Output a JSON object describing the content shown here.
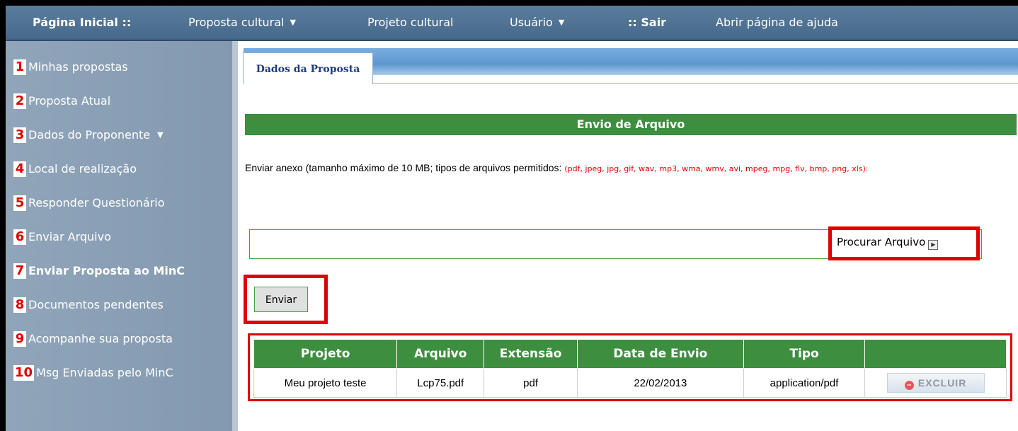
{
  "topbar": {
    "home": "Página Inicial ::",
    "menu": [
      {
        "label": "Proposta cultural",
        "dropdown": true
      },
      {
        "label": "Projeto cultural",
        "dropdown": false
      },
      {
        "label": "Usuário",
        "dropdown": true
      },
      {
        "label": ":: Sair",
        "dropdown": false
      },
      {
        "label": "Abrir página de ajuda",
        "dropdown": false
      }
    ]
  },
  "sidebar": {
    "items": [
      {
        "num": "1",
        "label": "Minhas propostas"
      },
      {
        "num": "2",
        "label": "Proposta Atual"
      },
      {
        "num": "3",
        "label": "Dados do Proponente"
      },
      {
        "num": "4",
        "label": "Local de realização"
      },
      {
        "num": "5",
        "label": "Responder Questionário"
      },
      {
        "num": "6",
        "label": "Enviar Arquivo"
      },
      {
        "num": "7",
        "label": "Enviar Proposta ao MinC"
      },
      {
        "num": "8",
        "label": "Documentos pendentes"
      },
      {
        "num": "9",
        "label": "Acompanhe sua proposta"
      },
      {
        "num": "10",
        "label": "Msg Enviadas pelo MinC"
      }
    ]
  },
  "main": {
    "tab": "Dados da Proposta",
    "section_title": "Envio de Arquivo",
    "upload_description": "Enviar anexo (tamanho máximo de 10 MB; tipos de arquivos permitidos: ",
    "upload_types": "(pdf, jpeg, jpg, gif, wav, mp3, wma, wmv, avi, mpeg, mpg, flv, bmp, png, xls):",
    "browse_label": "Procurar Arquivo",
    "send_label": "Enviar",
    "table": {
      "headers": [
        "Projeto",
        "Arquivo",
        "Extensão",
        "Data de Envio",
        "Tipo",
        ""
      ],
      "rows": [
        {
          "projeto": "Meu projeto teste",
          "arquivo": "Lcp75.pdf",
          "extensao": "pdf",
          "data": "22/02/2013",
          "tipo": "application/pdf",
          "action": "EXCLUIR"
        }
      ]
    }
  },
  "icons": {
    "browse": "play-arrow-icon",
    "delete": "minus-circle-icon",
    "dropdown": "caret-down-icon"
  },
  "colors": {
    "green": "#3e8e3f",
    "annotation_red": "#e00000",
    "topbar": "#4f7394",
    "sidebar": "#8a9fb4"
  }
}
